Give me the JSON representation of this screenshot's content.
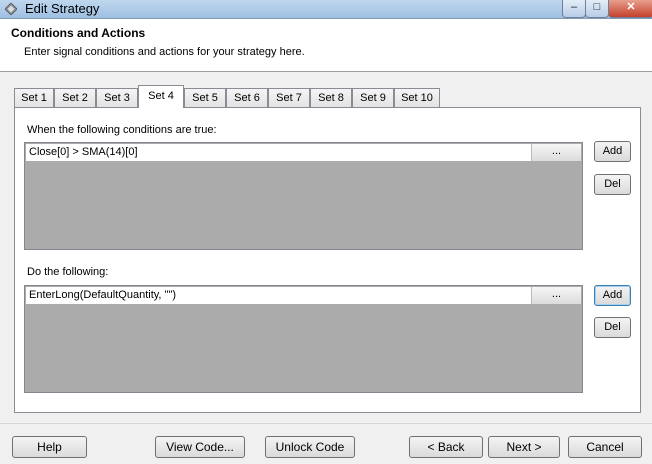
{
  "window": {
    "title": "Edit Strategy",
    "controls": {
      "minimize": "–",
      "maximize": "□",
      "close": "✕"
    }
  },
  "header": {
    "title": "Conditions and Actions",
    "subtitle": "Enter signal conditions and actions for your strategy here."
  },
  "tabs": [
    {
      "label": "Set 1"
    },
    {
      "label": "Set 2"
    },
    {
      "label": "Set 3"
    },
    {
      "label": "Set 4"
    },
    {
      "label": "Set 5"
    },
    {
      "label": "Set 6"
    },
    {
      "label": "Set 7"
    },
    {
      "label": "Set 8"
    },
    {
      "label": "Set 9"
    },
    {
      "label": "Set 10"
    }
  ],
  "active_tab": "Set 4",
  "conditions": {
    "label": "When the following conditions are true:",
    "items": [
      {
        "text": "Close[0] > SMA(14)[0]",
        "button": "..."
      }
    ],
    "add_label": "Add",
    "del_label": "Del"
  },
  "actions": {
    "label": "Do the following:",
    "items": [
      {
        "text": "EnterLong(DefaultQuantity, \"\")",
        "button": "..."
      }
    ],
    "add_label": "Add",
    "del_label": "Del"
  },
  "footer": {
    "help": "Help",
    "view_code": "View Code...",
    "unlock_code": "Unlock Code",
    "back": "< Back",
    "next": "Next >",
    "cancel": "Cancel"
  }
}
